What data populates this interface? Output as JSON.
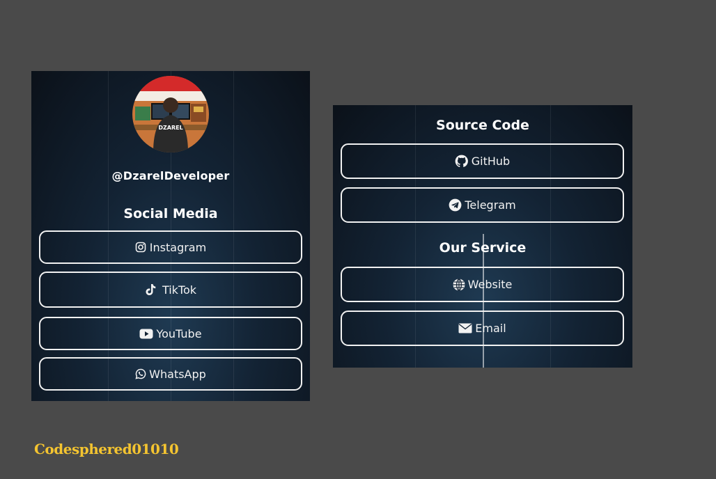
{
  "profile": {
    "handle": "@DzarelDeveloper",
    "avatar_text": "DZAREL"
  },
  "social_media": {
    "title": "Social Media",
    "links": [
      {
        "label": "Instagram",
        "icon": "instagram-icon"
      },
      {
        "label": "TikTok",
        "icon": "tiktok-icon"
      },
      {
        "label": "YouTube",
        "icon": "youtube-icon"
      },
      {
        "label": "WhatsApp",
        "icon": "whatsapp-icon"
      }
    ]
  },
  "source_code": {
    "title": "Source Code",
    "links": [
      {
        "label": "GitHub",
        "icon": "github-icon"
      },
      {
        "label": "Telegram",
        "icon": "telegram-icon"
      }
    ]
  },
  "our_service": {
    "title": "Our Service",
    "links": [
      {
        "label": "Website",
        "icon": "globe-icon"
      },
      {
        "label": "Email",
        "icon": "envelope-icon"
      }
    ]
  },
  "watermark": "Codesphered01010",
  "colors": {
    "background": "#4a4a4a",
    "panel": "#132334",
    "button_border": "#f2f2f2",
    "watermark": "#f4c430"
  }
}
